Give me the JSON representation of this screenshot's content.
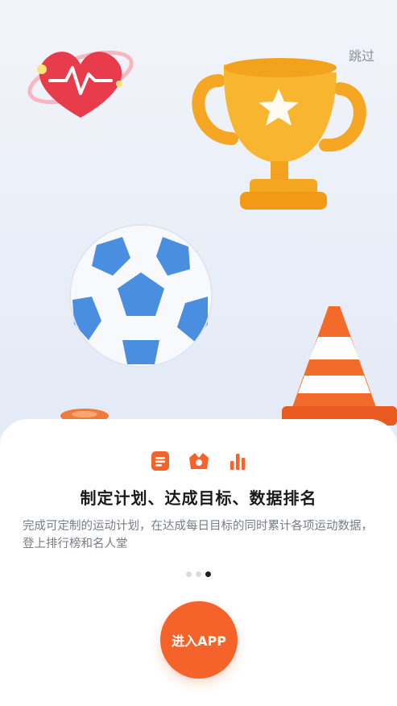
{
  "header": {
    "skip_label": "跳过"
  },
  "feature_icons": [
    "notepad-icon",
    "badge-icon",
    "bar-chart-icon"
  ],
  "sheet": {
    "title": "制定计划、达成目标、数据排名",
    "description": "完成可定制的运动计划，在达成每日目标的同时累计各项运动数据，登上排行榜和名人堂",
    "pager": {
      "total": 3,
      "active_index": 2
    },
    "cta_label": "进入APP"
  },
  "colors": {
    "accent": "#f5632a",
    "title": "#1a1a1a",
    "description": "#777c85",
    "skip": "#8a8f99",
    "dot_inactive": "#d9dbe0",
    "dot_active": "#1f1f1f"
  }
}
